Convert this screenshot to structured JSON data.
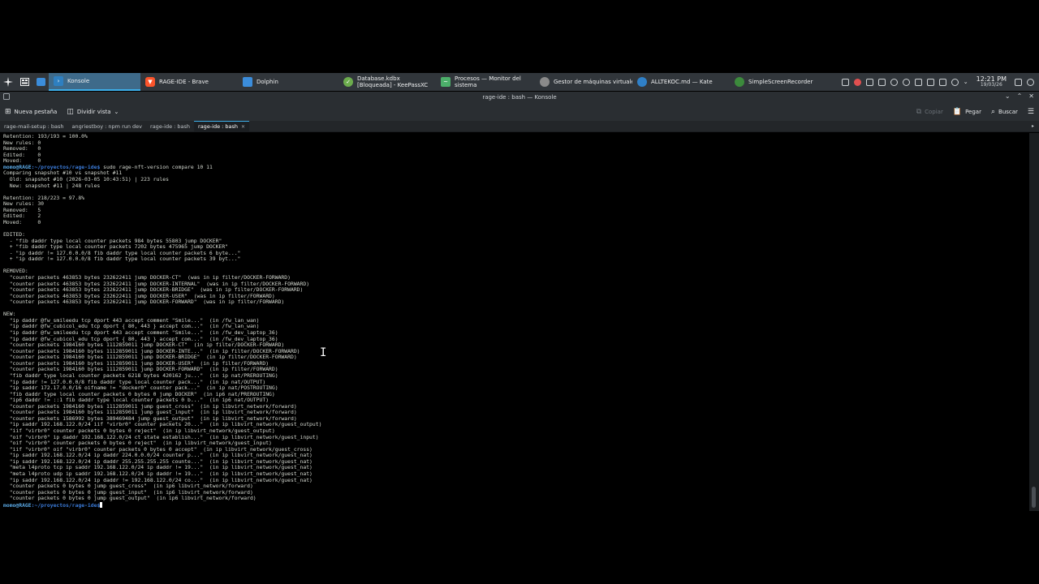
{
  "taskbar": {
    "tasks": [
      {
        "label": "Konsole",
        "icon": "konsole-icon",
        "color": "#2e7fc0",
        "active": true
      },
      {
        "label": "RAGE-IDE - Brave",
        "icon": "brave-icon",
        "color": "#fb542b"
      },
      {
        "label": "Dolphin",
        "icon": "dolphin-icon",
        "color": "#3b8ddb"
      },
      {
        "label": "Database.kdbx [Bloqueada] - KeePassXC",
        "icon": "keepassxc-icon",
        "color": "#6cac4d"
      },
      {
        "label": "Procesos — Monitor del sistema",
        "icon": "system-monitor-icon",
        "color": "#4caf6a"
      },
      {
        "label": "Gestor de máquinas virtuales",
        "icon": "virt-manager-icon",
        "color": "#8a8a8a"
      },
      {
        "label": "ALLTEKOC.md — Kate",
        "icon": "kate-icon",
        "color": "#2f80c8"
      },
      {
        "label": "SimpleScreenRecorder",
        "icon": "screen-recorder-icon",
        "color": "#3c8a3c"
      }
    ],
    "clock": {
      "time": "12:21 PM",
      "date": "19/03/26"
    }
  },
  "window": {
    "title": "rage-ide : bash — Konsole"
  },
  "toolbar": {
    "new_tab": "Nueva pestaña",
    "split_view": "Dividir vista",
    "copy": "Copiar",
    "paste": "Pegar",
    "search": "Buscar"
  },
  "tabs": [
    {
      "label": "rage-mail-setup : bash",
      "active": false
    },
    {
      "label": "angriestboy : npm run dev",
      "active": false
    },
    {
      "label": "rage-ide : bash",
      "active": false
    },
    {
      "label": "rage-ide : bash",
      "active": true
    }
  ],
  "terminal": {
    "prompt_user": "momo@RAGE",
    "prompt_path": ":~/proyectos/rage-ide$",
    "command": " sudo rage-nft-version compare 10 11",
    "lines_before": [
      "Retention: 193/193 = 100.0%",
      "New rules: 0",
      "Removed:   0",
      "Edited:    0",
      "Moved:     0"
    ],
    "output": [
      "Comparing snapshot #10 vs snapshot #11",
      "  Old: snapshot #10 (2026-03-05 10:43:51) | 223 rules",
      "  New: snapshot #11 | 248 rules",
      "",
      "Retention: 218/223 = 97.8%",
      "New rules: 30",
      "Removed:   5",
      "Edited:    2",
      "Moved:     0",
      "",
      "EDITED:",
      "  - \"fib daddr type local counter packets 984 bytes 55803 jump DOCKER\"",
      "  + \"fib daddr type local counter packets 7202 bytes 475965 jump DOCKER\"",
      "  - \"ip daddr != 127.0.0.0/8 fib daddr type local counter packets 6 byte...\"",
      "  + \"ip daddr != 127.0.0.0/8 fib daddr type local counter packets 39 byt...\"",
      "",
      "REMOVED:",
      "  \"counter packets 463853 bytes 232622411 jump DOCKER-CT\"  (was in ip filter/DOCKER-FORWARD)",
      "  \"counter packets 463853 bytes 232622411 jump DOCKER-INTERNAL\"  (was in ip filter/DOCKER-FORWARD)",
      "  \"counter packets 463853 bytes 232622411 jump DOCKER-BRIDGE\"  (was in ip filter/DOCKER-FORWARD)",
      "  \"counter packets 463853 bytes 232622411 jump DOCKER-USER\"  (was in ip filter/FORWARD)",
      "  \"counter packets 463853 bytes 232622411 jump DOCKER-FORWARD\"  (was in ip filter/FORWARD)",
      "",
      "NEW:",
      "  \"ip daddr @fw_smileedu tcp dport 443 accept comment \"Smile...\"  (in /fw_lan_wan)",
      "  \"ip daddr @fw_cubicol_edu tcp dport { 80, 443 } accept com...\"  (in /fw_lan_wan)",
      "  \"ip daddr @fw_smileedu tcp dport 443 accept comment \"Smile...\"  (in /fw_dev_laptop_36)",
      "  \"ip daddr @fw_cubicol_edu tcp dport { 80, 443 } accept com...\"  (in /fw_dev_laptop_36)",
      "  \"counter packets 1984160 bytes 1112859011 jump DOCKER-CT\"  (in ip filter/DOCKER-FORWARD)",
      "  \"counter packets 1984160 bytes 1112859011 jump DOCKER-INTE...\"  (in ip filter/DOCKER-FORWARD)",
      "  \"counter packets 1984160 bytes 1112859011 jump DOCKER-BRIDGE\"  (in ip filter/DOCKER-FORWARD)",
      "  \"counter packets 1984160 bytes 1112859011 jump DOCKER-USER\"  (in ip filter/FORWARD)",
      "  \"counter packets 1984160 bytes 1112859011 jump DOCKER-FORWARD\"  (in ip filter/FORWARD)",
      "  \"fib daddr type local counter packets 6218 bytes 420162 ju...\"  (in ip nat/PREROUTING)",
      "  \"ip daddr != 127.0.0.0/8 fib daddr type local counter pack...\"  (in ip nat/OUTPUT)",
      "  \"ip saddr 172.17.0.0/16 oifname != \"docker0\" counter pack...\"  (in ip nat/POSTROUTING)",
      "  \"fib daddr type local counter packets 0 bytes 0 jump DOCKER\"  (in ip6 nat/PREROUTING)",
      "  \"ip6 daddr != ::1 fib daddr type local counter packets 0 b...\"  (in ip6 nat/OUTPUT)",
      "  \"counter packets 1984160 bytes 1112859011 jump guest_cross\"  (in ip libvirt_network/forward)",
      "  \"counter packets 1984160 bytes 1112859011 jump guest_input\"  (in ip libvirt_network/forward)",
      "  \"counter packets 1586992 bytes 389469484 jump guest_output\"  (in ip libvirt_network/forward)",
      "  \"ip saddr 192.168.122.0/24 iif \"virbr0\" counter packets 20...\"  (in ip libvirt_network/guest_output)",
      "  \"iif \"virbr0\" counter packets 0 bytes 0 reject\"  (in ip libvirt_network/guest_output)",
      "  \"oif \"virbr0\" ip daddr 192.168.122.0/24 ct state establish...\"  (in ip libvirt_network/guest_input)",
      "  \"oif \"virbr0\" counter packets 0 bytes 0 reject\"  (in ip libvirt_network/guest_input)",
      "  \"iif \"virbr0\" oif \"virbr0\" counter packets 0 bytes 0 accept\"  (in ip libvirt_network/guest_cross)",
      "  \"ip saddr 192.168.122.0/24 ip daddr 224.0.0.0/24 counter p...\"  (in ip libvirt_network/guest_nat)",
      "  \"ip saddr 192.168.122.0/24 ip daddr 255.255.255.255 counte...\"  (in ip libvirt_network/guest_nat)",
      "  \"meta l4proto tcp ip saddr 192.168.122.0/24 ip daddr != 19...\"  (in ip libvirt_network/guest_nat)",
      "  \"meta l4proto udp ip saddr 192.168.122.0/24 ip daddr != 19...\"  (in ip libvirt_network/guest_nat)",
      "  \"ip saddr 192.168.122.0/24 ip daddr != 192.168.122.0/24 co...\"  (in ip libvirt_network/guest_nat)",
      "  \"counter packets 0 bytes 0 jump guest_cross\"  (in ip6 libvirt_network/forward)",
      "  \"counter packets 0 bytes 0 jump guest_input\"  (in ip6 libvirt_network/forward)",
      "  \"counter packets 0 bytes 0 jump guest_output\"  (in ip6 libvirt_network/forward)"
    ]
  }
}
